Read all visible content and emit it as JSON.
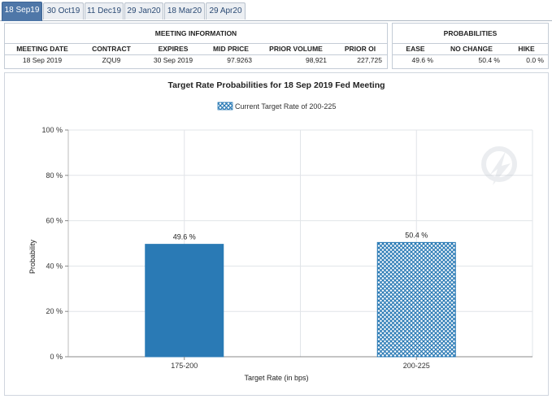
{
  "tabs": [
    {
      "label": "18 Sep19",
      "active": true
    },
    {
      "label": "30 Oct19",
      "active": false
    },
    {
      "label": "11 Dec19",
      "active": false
    },
    {
      "label": "29 Jan20",
      "active": false
    },
    {
      "label": "18 Mar20",
      "active": false
    },
    {
      "label": "29 Apr20",
      "active": false
    }
  ],
  "meeting_info": {
    "title": "MEETING INFORMATION",
    "headers": [
      "MEETING DATE",
      "CONTRACT",
      "EXPIRES",
      "MID PRICE",
      "PRIOR VOLUME",
      "PRIOR OI"
    ],
    "values": [
      "18 Sep 2019",
      "ZQU9",
      "30 Sep 2019",
      "97.9263",
      "98,921",
      "227,725"
    ]
  },
  "probabilities": {
    "title": "PROBABILITIES",
    "headers": [
      "EASE",
      "NO CHANGE",
      "HIKE"
    ],
    "values": [
      "49.6 %",
      "50.4 %",
      "0.0 %"
    ]
  },
  "colors": {
    "bar_primary": "#2a7ab5",
    "bar_hatch": "#2a7ab5",
    "tab_active": "#4f77a8"
  },
  "chart_data": {
    "type": "bar",
    "title": "Target Rate Probabilities for 18 Sep 2019 Fed Meeting",
    "legend": "Current Target Rate of 200-225",
    "legend_position": "top-center",
    "categories": [
      "175-200",
      "200-225"
    ],
    "values": [
      49.6,
      50.4
    ],
    "data_labels": [
      "49.6 %",
      "50.4 %"
    ],
    "patterns": [
      "solid",
      "crosshatch"
    ],
    "xlabel": "Target Rate (in bps)",
    "ylabel": "Probability",
    "ylim": [
      0,
      100
    ],
    "yticks": [
      "0 %",
      "20 %",
      "40 %",
      "60 %",
      "80 %",
      "100 %"
    ],
    "grid": true
  }
}
